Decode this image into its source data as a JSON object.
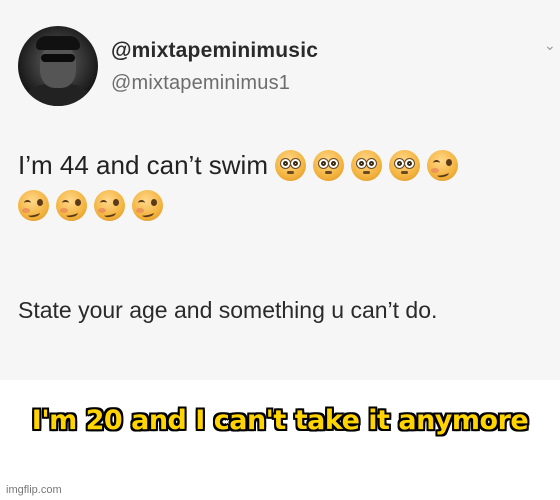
{
  "tweet": {
    "display_name": "@mixtapeminimusic",
    "handle": "@mixtapeminimus1",
    "text": "I’m 44 and can’t swim",
    "emojis_line1": [
      "flushed-face-emoji",
      "flushed-face-emoji",
      "flushed-face-emoji",
      "flushed-face-emoji",
      "woozy-face-emoji"
    ],
    "emojis_line2": [
      "woozy-face-emoji",
      "woozy-face-emoji",
      "woozy-face-emoji",
      "woozy-face-emoji"
    ],
    "quoted_text": "State your age and something u can’t do."
  },
  "meme": {
    "caption": "I'm 20 and I can't take it anymore",
    "caption_color": "#ffd400"
  },
  "watermark": "imgflip.com"
}
